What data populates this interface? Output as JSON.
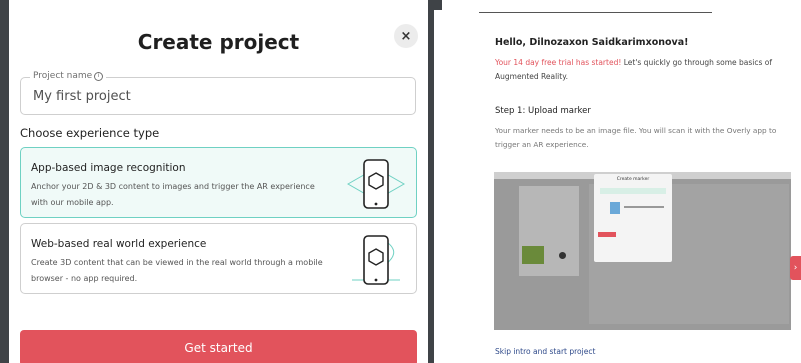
{
  "modal": {
    "title": "Create project",
    "close_glyph": "×",
    "project_name_label": "Project name",
    "project_name_info_glyph": "i",
    "project_name_value": "My first project",
    "experience_label": "Choose experience type",
    "options": [
      {
        "title": "App-based image recognition",
        "description": "Anchor your 2D & 3D content to images and trigger the AR experience with our mobile app.",
        "selected": true,
        "icon": "phone-image-target-icon"
      },
      {
        "title": "Web-based real world experience",
        "description": "Create 3D content that can be viewed in the real world through a mobile browser - no app required.",
        "selected": false,
        "icon": "phone-world-anchor-icon"
      }
    ],
    "cta_label": "Get started"
  },
  "onboarding": {
    "greeting": "Hello, Dilnozaxon Saidkarimxonova!",
    "trial_highlight": "Your 14 day free trial has started!",
    "trial_rest": " Let's quickly go through some basics of Augmented Reality.",
    "step_title": "Step 1: Upload marker",
    "step_desc": "Your marker needs to be an image file. You will scan it with the Overly app to trigger an AR experience.",
    "preview_dialog_title": "Create marker",
    "side_tab_glyph": "›",
    "skip_link": "Skip intro and start project"
  },
  "colors": {
    "accent_red": "#e2535c",
    "accent_teal": "#6fd1c3",
    "selected_bg": "#f0faf8",
    "backdrop": "#3f4347",
    "link": "#2f4a8a"
  }
}
